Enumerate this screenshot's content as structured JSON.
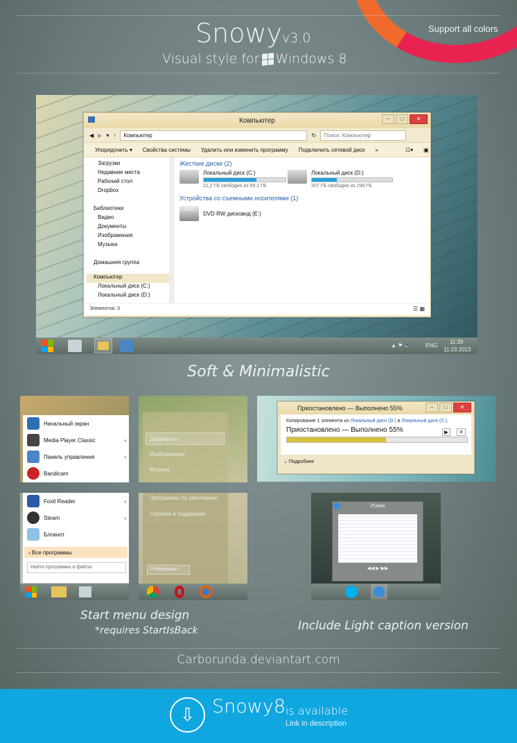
{
  "header": {
    "title": "Snowy",
    "version": "v3.0",
    "subtitle_pre": "Visual style for ",
    "subtitle_post": "Windows 8",
    "support": "Support all colors"
  },
  "explorer": {
    "title": "Компьютер",
    "address": "Компьютер",
    "search_placeholder": "Поиск: Компьютер",
    "toolbar": [
      "Упорядочить ▾",
      "Свойства системы",
      "Удалить или изменить программу",
      "Подключить сетевой диск",
      "»"
    ],
    "nav": [
      "Загрузки",
      "Недавние места",
      "Рабочий стол",
      "Dropbox",
      "Библиотеки",
      "Видео",
      "Документы",
      "Изображения",
      "Музыка",
      "Домашняя группа",
      "Компьютер",
      "Локальный диск (C:)",
      "Локальный диск (D:)"
    ],
    "group_hdd": "Жесткие диски (2)",
    "group_removable": "Устройства со съемными носителями (1)",
    "drives": [
      {
        "name": "Локальный диск (C:)",
        "free": "21,2 ГБ свободно из 59,1 ГБ",
        "fill": 0.64
      },
      {
        "name": "Локальный диск (D:)",
        "free": "207 ГБ свободно из 298 ГБ",
        "fill": 0.31
      }
    ],
    "dvd": "DVD RW дисковод (E:)",
    "dvd_label": "DVD",
    "status": "Элементов: 3"
  },
  "taskbar": {
    "lang": "ENG",
    "time": "11:39",
    "date": "11.03.2013"
  },
  "tagline": "Soft & Minimalistic",
  "start1": {
    "items": [
      "Начальный экран",
      "Media Player Classic",
      "Панель управления",
      "Bandicam"
    ],
    "right": [
      "Документы",
      "Изображения",
      "Музыка"
    ]
  },
  "start2": {
    "items": [
      "Foxit Reader",
      "Steam",
      "Блокнот"
    ],
    "all_programs": "Все программы",
    "search_placeholder": "Найти программы и файлы",
    "right": [
      "Программы по умолчанию",
      "Справка и поддержка"
    ],
    "hibernate": "Гибернация"
  },
  "copy": {
    "title": "Приостановлено — Выполнено 55%",
    "line_pre": "Копирование 1 элемента из ",
    "src": "Локальный диск (D:)",
    "mid": " в ",
    "dst": "Локальный диск (C:)",
    "status": "Приостановлено — Выполнено 55%",
    "progress": 0.55,
    "more": "Подробнее"
  },
  "itunes": {
    "title": "iTunes"
  },
  "captions": {
    "start": "Start menu design",
    "requires": "*requires StartIsBack",
    "light": "Include Light caption version"
  },
  "credit": "Carborunda.deviantart.com",
  "footer": {
    "name": "Snowy8",
    "available": "is available",
    "link": "Link in description"
  }
}
